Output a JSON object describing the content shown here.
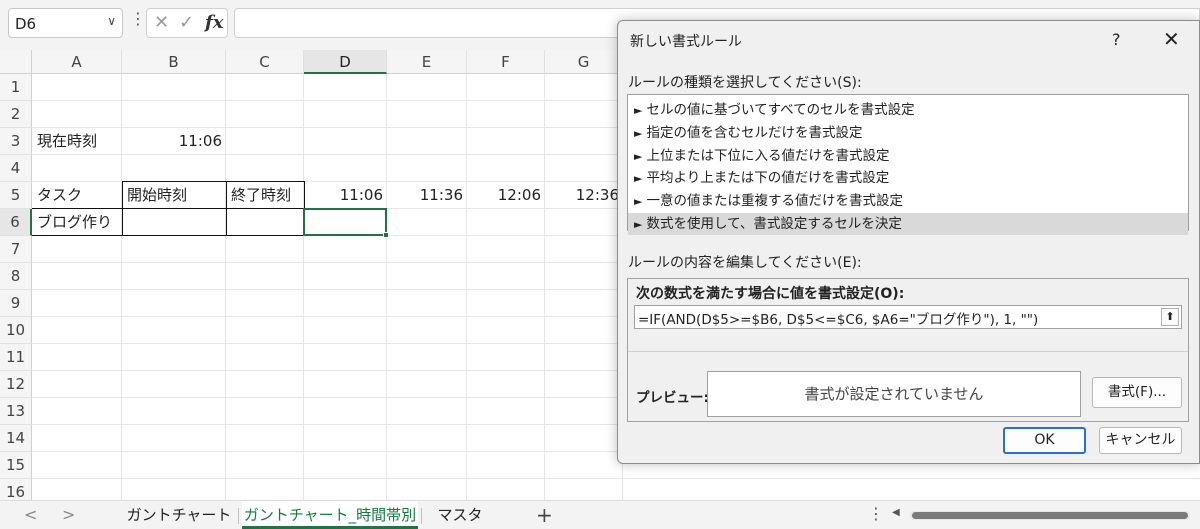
{
  "formula_bar": {
    "name_box": "D6",
    "name_box_chevron": "∨",
    "more_dots": "⋮",
    "cancel_icon": "✕",
    "enter_icon": "✓",
    "fx_label": "fx",
    "formula": ""
  },
  "grid": {
    "columns": [
      "A",
      "B",
      "C",
      "D",
      "E",
      "F",
      "G"
    ],
    "active_column": "D",
    "rows": [
      "1",
      "2",
      "3",
      "4",
      "5",
      "6",
      "7",
      "8",
      "9",
      "10",
      "11",
      "12",
      "13",
      "14",
      "15",
      "16"
    ],
    "active_row": "6",
    "cells": {
      "A3": "現在時刻",
      "B3": "11:06",
      "A5": "タスク",
      "B5": "開始時刻",
      "C5": "終了時刻",
      "D5": "11:06",
      "E5": "11:36",
      "F5": "12:06",
      "G5": "12:36",
      "A6": "ブログ作り"
    }
  },
  "sheet_tabs": {
    "nav_prev": "<",
    "nav_next": ">",
    "tabs": [
      "ガントチャート",
      "ガントチャート_時間帯別",
      "マスタ"
    ],
    "active_tab": 1,
    "add_label": "+",
    "more_dots": "⋮",
    "scroll_left": "◀"
  },
  "dialog": {
    "title": "新しい書式ルール",
    "help": "?",
    "close": "✕",
    "rule_type_label": "ルールの種類を選択してください(S):",
    "rule_types": [
      "セルの値に基づいてすべてのセルを書式設定",
      "指定の値を含むセルだけを書式設定",
      "上位または下位に入る値だけを書式設定",
      "平均より上または下の値だけを書式設定",
      "一意の値または重複する値だけを書式設定",
      "数式を使用して、書式設定するセルを決定"
    ],
    "rule_type_marker": "►",
    "selected_rule_type": 5,
    "edit_label": "ルールの内容を編集してください(E):",
    "condition_label": "次の数式を満たす場合に値を書式設定(O):",
    "formula": "=IF(AND(D$5>=$B6, D$5<=$C6, $A6=\"ブログ作り\"), 1, \"\")",
    "collapse_icon": "⬆",
    "preview_label": "プレビュー:",
    "preview_text": "書式が設定されていません",
    "format_button": "書式(F)...",
    "ok_button": "OK",
    "cancel_button": "キャンセル"
  },
  "colors": {
    "accent": "#217346",
    "ok_border": "#2b6fd1"
  }
}
